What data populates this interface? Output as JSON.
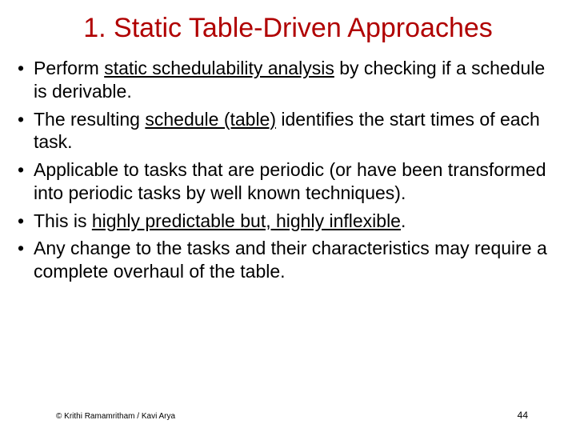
{
  "title": "1. Static Table-Driven Approaches",
  "bullets": {
    "b1_a": "Perform ",
    "b1_u": "static schedulability analysis",
    "b1_b": " by checking if a schedule is derivable.",
    "b2_a": "The resulting ",
    "b2_u": "schedule (table)",
    "b2_b": " identifies the start  times of each task.",
    "b3": "Applicable to tasks that are periodic (or have been transformed into periodic tasks by well known techniques).",
    "b4_a": "This is  ",
    "b4_u": "highly predictable but, highly inflexible",
    "b4_b": ".",
    "b5": "Any change to the tasks and their characteristics may require a complete overhaul of the table."
  },
  "footer": {
    "copyright": "© Krithi Ramamritham / Kavi Arya",
    "page": "44"
  }
}
